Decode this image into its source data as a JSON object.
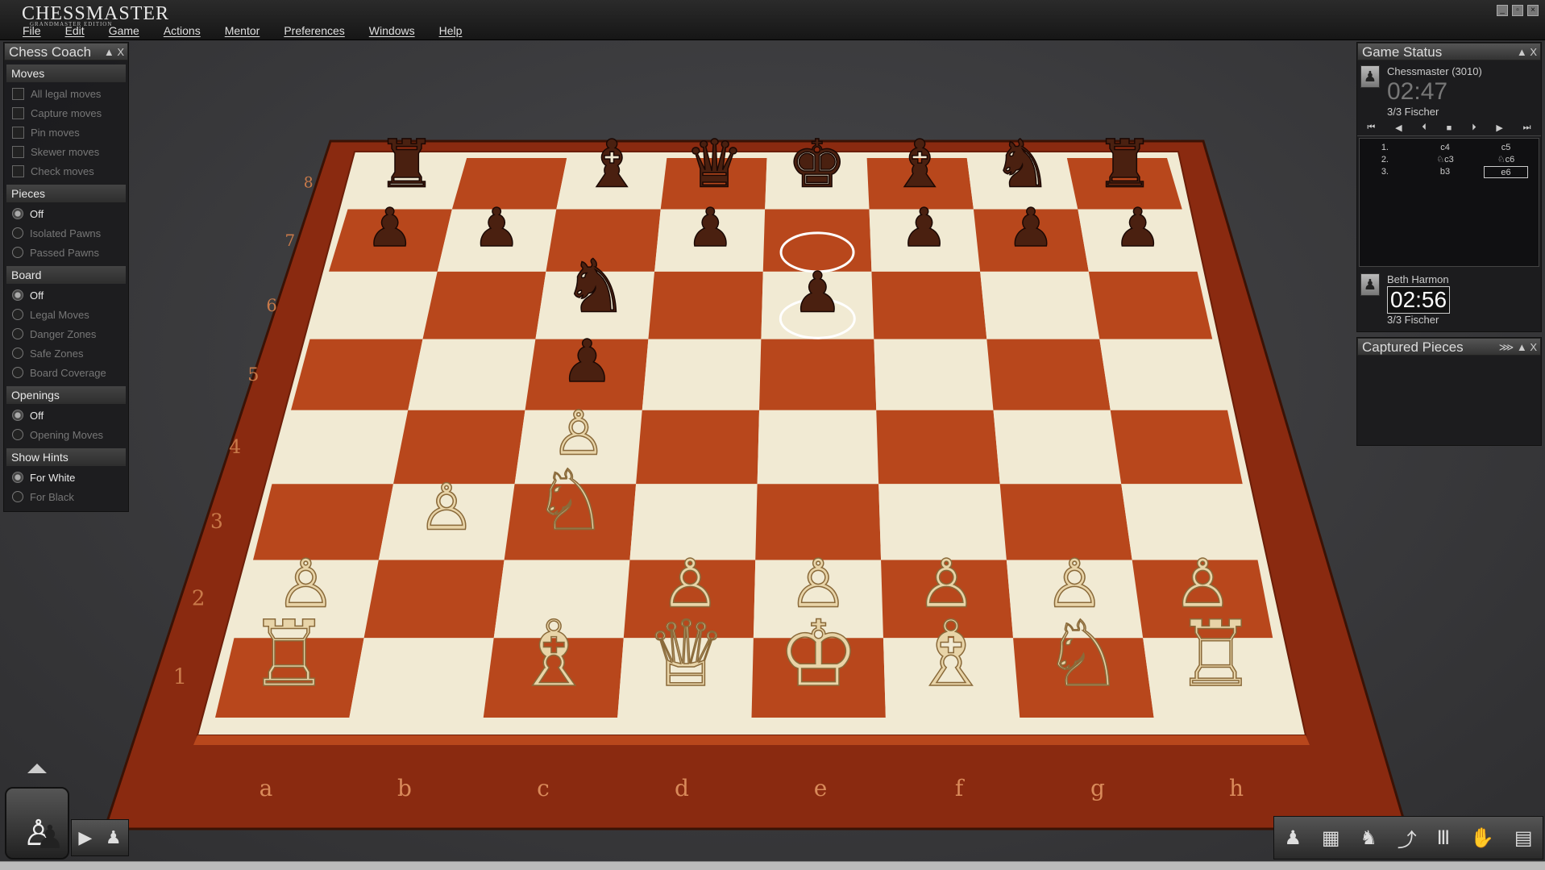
{
  "app": {
    "logo": "CHESSMASTER",
    "logo_sub": "GRANDMASTER EDITION"
  },
  "menu": [
    "File",
    "Edit",
    "Game",
    "Actions",
    "Mentor",
    "Preferences",
    "Windows",
    "Help"
  ],
  "coach": {
    "title": "Chess Coach",
    "sections": [
      {
        "name": "Moves",
        "type": "check",
        "options": [
          {
            "label": "All legal moves",
            "selected": false
          },
          {
            "label": "Capture moves",
            "selected": false
          },
          {
            "label": "Pin moves",
            "selected": false
          },
          {
            "label": "Skewer moves",
            "selected": false
          },
          {
            "label": "Check moves",
            "selected": false
          }
        ]
      },
      {
        "name": "Pieces",
        "type": "radio",
        "options": [
          {
            "label": "Off",
            "selected": true
          },
          {
            "label": "Isolated Pawns",
            "selected": false
          },
          {
            "label": "Passed Pawns",
            "selected": false
          }
        ]
      },
      {
        "name": "Board",
        "type": "radio",
        "options": [
          {
            "label": "Off",
            "selected": true
          },
          {
            "label": "Legal Moves",
            "selected": false
          },
          {
            "label": "Danger Zones",
            "selected": false
          },
          {
            "label": "Safe Zones",
            "selected": false
          },
          {
            "label": "Board Coverage",
            "selected": false
          }
        ]
      },
      {
        "name": "Openings",
        "type": "radio",
        "options": [
          {
            "label": "Off",
            "selected": true
          },
          {
            "label": "Opening Moves",
            "selected": false
          }
        ]
      },
      {
        "name": "Show Hints",
        "type": "radio",
        "options": [
          {
            "label": "For White",
            "selected": true
          },
          {
            "label": "For Black",
            "selected": false
          }
        ]
      }
    ]
  },
  "status": {
    "title": "Game Status",
    "top_player": {
      "name": "Chessmaster (3010)",
      "clock": "02:47",
      "time_control": "3/3 Fischer"
    },
    "bottom_player": {
      "name": "Beth Harmon",
      "clock": "02:56",
      "time_control": "3/3 Fischer"
    },
    "moves": [
      {
        "n": "1.",
        "w": "c4",
        "b": "c5"
      },
      {
        "n": "2.",
        "w": "♘c3",
        "b": "♘c6"
      },
      {
        "n": "3.",
        "w": "b3",
        "b": "e6"
      }
    ]
  },
  "captured": {
    "title": "Captured Pieces"
  },
  "board": {
    "files": [
      "a",
      "b",
      "c",
      "d",
      "e",
      "f",
      "g",
      "h"
    ],
    "ranks": [
      "1",
      "2",
      "3",
      "4",
      "5",
      "6",
      "7",
      "8"
    ],
    "light_color": "#f1ead3",
    "dark_color": "#b8471c",
    "frame_color": "#8a2a10",
    "pieces": [
      {
        "sq": "a8",
        "p": "r",
        "c": "b"
      },
      {
        "sq": "c8",
        "p": "b",
        "c": "b"
      },
      {
        "sq": "d8",
        "p": "q",
        "c": "b"
      },
      {
        "sq": "e8",
        "p": "k",
        "c": "b"
      },
      {
        "sq": "f8",
        "p": "b",
        "c": "b"
      },
      {
        "sq": "g8",
        "p": "n",
        "c": "b"
      },
      {
        "sq": "h8",
        "p": "r",
        "c": "b"
      },
      {
        "sq": "a7",
        "p": "p",
        "c": "b"
      },
      {
        "sq": "b7",
        "p": "p",
        "c": "b"
      },
      {
        "sq": "d7",
        "p": "p",
        "c": "b"
      },
      {
        "sq": "f7",
        "p": "p",
        "c": "b"
      },
      {
        "sq": "g7",
        "p": "p",
        "c": "b"
      },
      {
        "sq": "h7",
        "p": "p",
        "c": "b"
      },
      {
        "sq": "c6",
        "p": "n",
        "c": "b"
      },
      {
        "sq": "e6",
        "p": "p",
        "c": "b"
      },
      {
        "sq": "c5",
        "p": "p",
        "c": "b"
      },
      {
        "sq": "c4",
        "p": "p",
        "c": "w"
      },
      {
        "sq": "b3",
        "p": "p",
        "c": "w"
      },
      {
        "sq": "c3",
        "p": "n",
        "c": "w"
      },
      {
        "sq": "a2",
        "p": "p",
        "c": "w"
      },
      {
        "sq": "d2",
        "p": "p",
        "c": "w"
      },
      {
        "sq": "e2",
        "p": "p",
        "c": "w"
      },
      {
        "sq": "f2",
        "p": "p",
        "c": "w"
      },
      {
        "sq": "g2",
        "p": "p",
        "c": "w"
      },
      {
        "sq": "h2",
        "p": "p",
        "c": "w"
      },
      {
        "sq": "a1",
        "p": "r",
        "c": "w"
      },
      {
        "sq": "c1",
        "p": "b",
        "c": "w"
      },
      {
        "sq": "d1",
        "p": "q",
        "c": "w"
      },
      {
        "sq": "e1",
        "p": "k",
        "c": "w"
      },
      {
        "sq": "f1",
        "p": "b",
        "c": "w"
      },
      {
        "sq": "g1",
        "p": "n",
        "c": "w"
      },
      {
        "sq": "h1",
        "p": "r",
        "c": "w"
      }
    ],
    "highlights": [
      "e7",
      "e6"
    ]
  }
}
